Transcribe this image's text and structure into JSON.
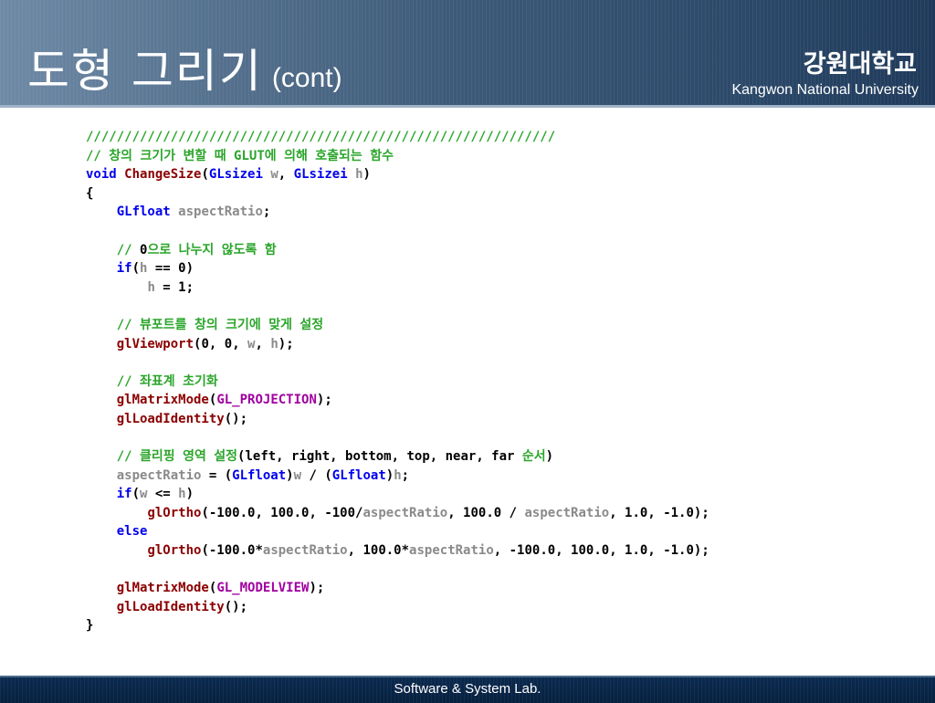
{
  "header": {
    "title": "도형 그리기",
    "title_suffix": "(cont)",
    "university_ko": "강원대학교",
    "university_en": "Kangwon National University"
  },
  "colors": {
    "comment": "#2aa52a",
    "keyword": "#0000ee",
    "function": "#8b0000",
    "variable": "#8a8a8a",
    "macro": "#a000a0",
    "header_bg": "#3d5978",
    "footer_bg": "#06203f"
  },
  "code": {
    "lines": [
      [
        [
          "c",
          "/////////////////////////////////////////////////////////////"
        ]
      ],
      [
        [
          "c",
          "// 창의 크기가 변할 때 GLUT에 의해 호출되는 함수"
        ]
      ],
      [
        [
          "k",
          "void"
        ],
        [
          "p",
          " "
        ],
        [
          "fn",
          "ChangeSize"
        ],
        [
          "p",
          "("
        ],
        [
          "k",
          "GLsizei"
        ],
        [
          "p",
          " "
        ],
        [
          "v",
          "w"
        ],
        [
          "p",
          ", "
        ],
        [
          "k",
          "GLsizei"
        ],
        [
          "p",
          " "
        ],
        [
          "v",
          "h"
        ],
        [
          "p",
          ")"
        ]
      ],
      [
        [
          "p",
          "{"
        ]
      ],
      [
        [
          "p",
          "    "
        ],
        [
          "k",
          "GLfloat"
        ],
        [
          "p",
          " "
        ],
        [
          "v",
          "aspectRatio"
        ],
        [
          "p",
          ";"
        ]
      ],
      [],
      [
        [
          "p",
          "    "
        ],
        [
          "c",
          "// "
        ],
        [
          "n",
          "0"
        ],
        [
          "c",
          "으로 나누지 않도록 함"
        ]
      ],
      [
        [
          "p",
          "    "
        ],
        [
          "k",
          "if"
        ],
        [
          "p",
          "("
        ],
        [
          "v",
          "h"
        ],
        [
          "p",
          " == "
        ],
        [
          "n",
          "0"
        ],
        [
          "p",
          ")"
        ]
      ],
      [
        [
          "p",
          "        "
        ],
        [
          "v",
          "h"
        ],
        [
          "p",
          " = "
        ],
        [
          "n",
          "1"
        ],
        [
          "p",
          ";"
        ]
      ],
      [],
      [
        [
          "p",
          "    "
        ],
        [
          "c",
          "// 뷰포트를 창의 크기에 맞게 설정"
        ]
      ],
      [
        [
          "p",
          "    "
        ],
        [
          "fn",
          "glViewport"
        ],
        [
          "p",
          "("
        ],
        [
          "n",
          "0"
        ],
        [
          "p",
          ", "
        ],
        [
          "n",
          "0"
        ],
        [
          "p",
          ", "
        ],
        [
          "v",
          "w"
        ],
        [
          "p",
          ", "
        ],
        [
          "v",
          "h"
        ],
        [
          "p",
          ");"
        ]
      ],
      [],
      [
        [
          "p",
          "    "
        ],
        [
          "c",
          "// 좌표계 초기화"
        ]
      ],
      [
        [
          "p",
          "    "
        ],
        [
          "fn",
          "glMatrixMode"
        ],
        [
          "p",
          "("
        ],
        [
          "m",
          "GL_PROJECTION"
        ],
        [
          "p",
          ");"
        ]
      ],
      [
        [
          "p",
          "    "
        ],
        [
          "fn",
          "glLoadIdentity"
        ],
        [
          "p",
          "();"
        ]
      ],
      [],
      [
        [
          "p",
          "    "
        ],
        [
          "c",
          "// 클리핑 영역 설정"
        ],
        [
          "p",
          "(left, right, bottom, top, near, far "
        ],
        [
          "c",
          "순서"
        ],
        [
          "p",
          ")"
        ]
      ],
      [
        [
          "p",
          "    "
        ],
        [
          "v",
          "aspectRatio"
        ],
        [
          "p",
          " = ("
        ],
        [
          "k",
          "GLfloat"
        ],
        [
          "p",
          ")"
        ],
        [
          "v",
          "w"
        ],
        [
          "p",
          " / ("
        ],
        [
          "k",
          "GLfloat"
        ],
        [
          "p",
          ")"
        ],
        [
          "v",
          "h"
        ],
        [
          "p",
          ";"
        ]
      ],
      [
        [
          "p",
          "    "
        ],
        [
          "k",
          "if"
        ],
        [
          "p",
          "("
        ],
        [
          "v",
          "w"
        ],
        [
          "p",
          " <= "
        ],
        [
          "v",
          "h"
        ],
        [
          "p",
          ")"
        ]
      ],
      [
        [
          "p",
          "        "
        ],
        [
          "fn",
          "glOrtho"
        ],
        [
          "p",
          "(-100.0, 100.0, -100/"
        ],
        [
          "v",
          "aspectRatio"
        ],
        [
          "p",
          ", 100.0 / "
        ],
        [
          "v",
          "aspectRatio"
        ],
        [
          "p",
          ", 1.0, -1.0);"
        ]
      ],
      [
        [
          "p",
          "    "
        ],
        [
          "k",
          "else"
        ]
      ],
      [
        [
          "p",
          "        "
        ],
        [
          "fn",
          "glOrtho"
        ],
        [
          "p",
          "(-100.0*"
        ],
        [
          "v",
          "aspectRatio"
        ],
        [
          "p",
          ", 100.0*"
        ],
        [
          "v",
          "aspectRatio"
        ],
        [
          "p",
          ", -100.0, 100.0, 1.0, -1.0);"
        ]
      ],
      [],
      [
        [
          "p",
          "    "
        ],
        [
          "fn",
          "glMatrixMode"
        ],
        [
          "p",
          "("
        ],
        [
          "m",
          "GL_MODELVIEW"
        ],
        [
          "p",
          ");"
        ]
      ],
      [
        [
          "p",
          "    "
        ],
        [
          "fn",
          "glLoadIdentity"
        ],
        [
          "p",
          "();"
        ]
      ],
      [
        [
          "p",
          "}"
        ]
      ]
    ]
  },
  "footer": {
    "text": "Software & System Lab."
  }
}
